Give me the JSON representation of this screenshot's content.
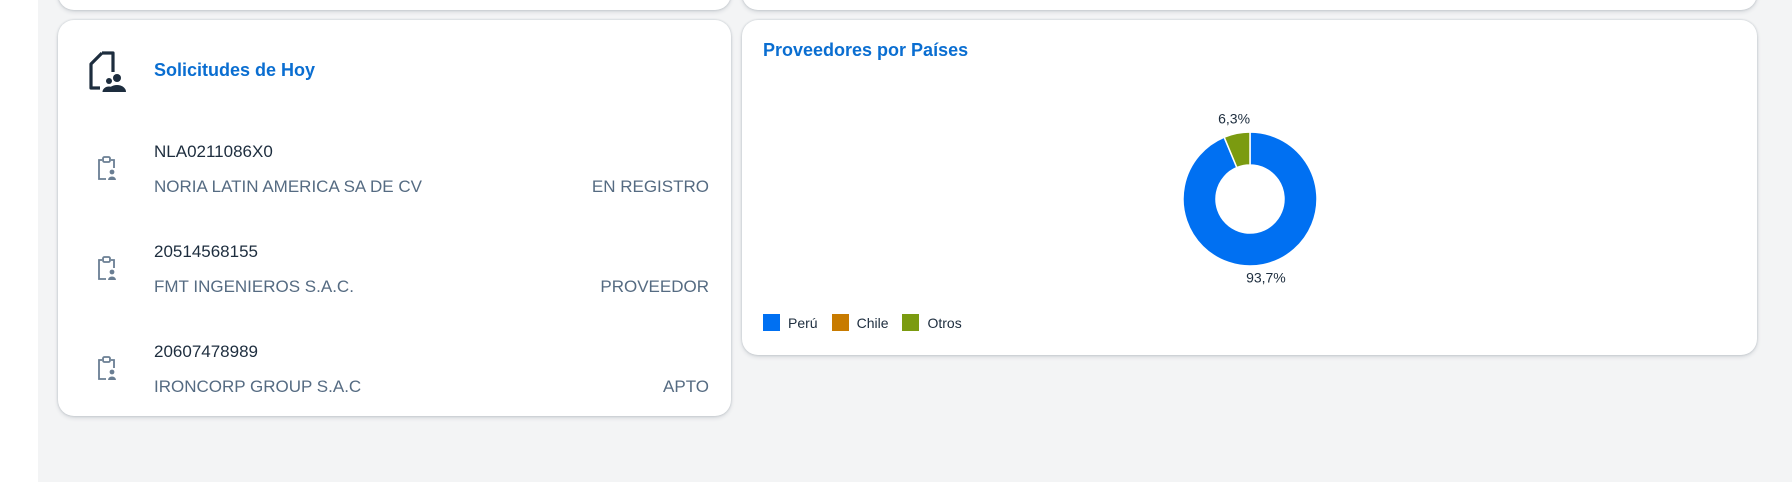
{
  "requests_card": {
    "title": "Solicitudes de Hoy",
    "items": [
      {
        "id": "NLA0211086X0",
        "name": "NORIA LATIN AMERICA SA DE CV",
        "status": "EN REGISTRO"
      },
      {
        "id": "20514568155",
        "name": "FMT INGENIEROS S.A.C.",
        "status": "PROVEEDOR"
      },
      {
        "id": "20607478989",
        "name": "IRONCORP GROUP S.A.C",
        "status": "APTO"
      }
    ]
  },
  "chart_card": {
    "title": "Proveedores por Países",
    "legend": [
      {
        "label": "Perú",
        "color": "#0070f2"
      },
      {
        "label": "Chile",
        "color": "#c87b00"
      },
      {
        "label": "Otros",
        "color": "#7b9b10"
      }
    ]
  },
  "chart_data": {
    "type": "pie",
    "title": "Proveedores por Países",
    "donut": true,
    "legend_position": "bottom-left",
    "slices": [
      {
        "label": "Perú",
        "value": 93.7,
        "display": "93,7%",
        "color": "#0070f2"
      },
      {
        "label": "Chile",
        "value": 0,
        "display": "",
        "color": "#c87b00"
      },
      {
        "label": "Otros",
        "value": 6.3,
        "display": "6,3%",
        "color": "#7b9b10"
      }
    ]
  }
}
